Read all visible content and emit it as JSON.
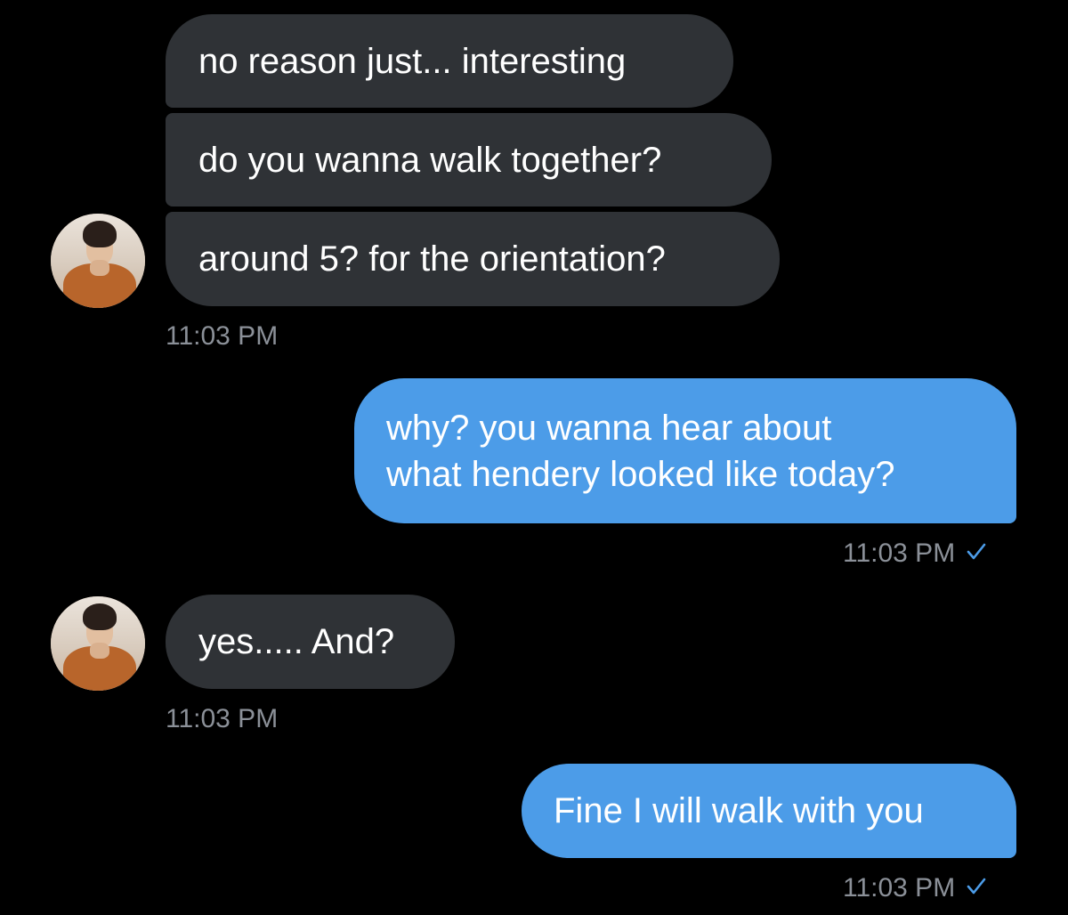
{
  "conversation": {
    "incoming_group_1": {
      "messages": [
        "no reason just... interesting",
        "do you wanna walk together?",
        "around 5? for the orientation?"
      ],
      "time": "11:03 PM"
    },
    "outgoing_1": {
      "lines": [
        "why? you wanna hear about",
        "what hendery looked like today?"
      ],
      "time": "11:03 PM"
    },
    "incoming_2": {
      "message": "yes..... And?",
      "time": "11:03 PM"
    },
    "outgoing_2": {
      "message": "Fine I will walk with you",
      "time": "11:03 PM"
    }
  },
  "icons": {
    "read_receipt": "checkmark-icon",
    "avatar": "contact-avatar"
  },
  "colors": {
    "background": "#000000",
    "incoming_bubble": "#2f3236",
    "outgoing_bubble": "#4c9ce8",
    "timestamp": "#8b9098",
    "check": "#4c9ce8"
  }
}
